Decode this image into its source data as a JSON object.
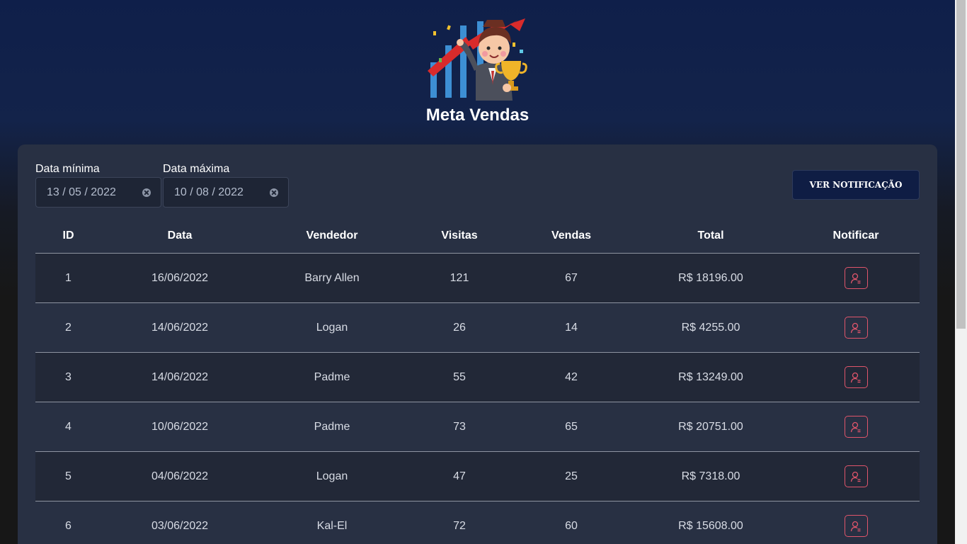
{
  "header": {
    "title": "Meta Vendas",
    "logo_icon": "sales-trophy-mascot-logo"
  },
  "filters": {
    "min_label": "Data mínima",
    "min_value": "13 / 05 / 2022",
    "max_label": "Data máxima",
    "max_value": "10 / 08 / 2022"
  },
  "notification_button": "VER NOTIFICAÇÃO",
  "table": {
    "columns": [
      "ID",
      "Data",
      "Vendedor",
      "Visitas",
      "Vendas",
      "Total",
      "Notificar"
    ],
    "rows": [
      {
        "id": "1",
        "date": "16/06/2022",
        "seller": "Barry Allen",
        "visits": "121",
        "sales": "67",
        "total": "R$ 18196.00"
      },
      {
        "id": "2",
        "date": "14/06/2022",
        "seller": "Logan",
        "visits": "26",
        "sales": "14",
        "total": "R$ 4255.00"
      },
      {
        "id": "3",
        "date": "14/06/2022",
        "seller": "Padme",
        "visits": "55",
        "sales": "42",
        "total": "R$ 13249.00"
      },
      {
        "id": "4",
        "date": "10/06/2022",
        "seller": "Padme",
        "visits": "73",
        "sales": "65",
        "total": "R$ 20751.00"
      },
      {
        "id": "5",
        "date": "04/06/2022",
        "seller": "Logan",
        "visits": "47",
        "sales": "25",
        "total": "R$ 7318.00"
      },
      {
        "id": "6",
        "date": "03/06/2022",
        "seller": "Kal-El",
        "visits": "72",
        "sales": "60",
        "total": "R$ 15608.00"
      }
    ],
    "notify_icon": "user-notify-icon"
  },
  "colors": {
    "accent": "#e0556b",
    "card": "#283043",
    "header_bg": "#0f1f4a"
  }
}
